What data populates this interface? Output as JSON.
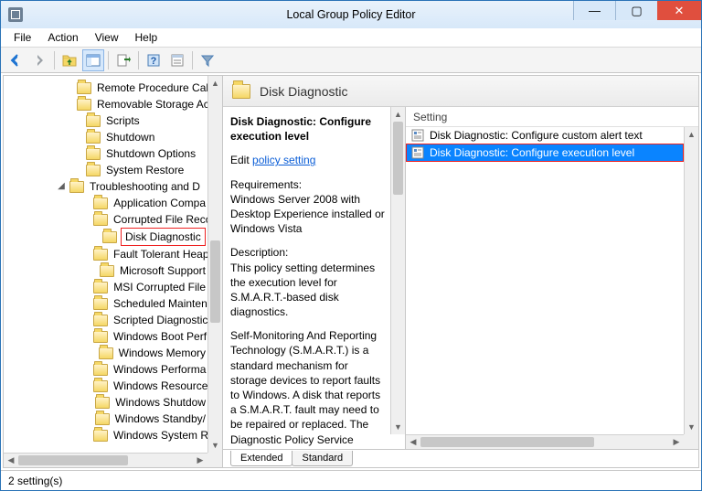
{
  "window": {
    "title": "Local Group Policy Editor"
  },
  "menubar": [
    "File",
    "Action",
    "View",
    "Help"
  ],
  "tree": {
    "top": [
      "Remote Procedure Cal",
      "Removable Storage Ac",
      "Scripts",
      "Shutdown",
      "Shutdown Options",
      "System Restore"
    ],
    "expanded": {
      "label": "Troubleshooting and D",
      "children": [
        "Application Compa",
        "Corrupted File Reco",
        "Disk Diagnostic",
        "Fault Tolerant Heap",
        "Microsoft Support",
        "MSI Corrupted File",
        "Scheduled Mainten",
        "Scripted Diagnostic",
        "Windows Boot Perf",
        "Windows Memory",
        "Windows Performa",
        "Windows Resource",
        "Windows Shutdow",
        "Windows Standby/",
        "Windows System R"
      ],
      "selected_index": 2
    }
  },
  "header": {
    "title": "Disk Diagnostic"
  },
  "description": {
    "title": "Disk Diagnostic: Configure execution level",
    "edit_prefix": "Edit ",
    "edit_link": "policy setting",
    "requirements_label": "Requirements:",
    "requirements_text": "Windows Server 2008 with Desktop Experience installed or Windows Vista",
    "description_label": "Description:",
    "description_text": "This policy setting determines the execution level for S.M.A.R.T.-based disk diagnostics.",
    "paragraph2": "Self-Monitoring And Reporting Technology (S.M.A.R.T.) is a standard mechanism for storage devices to report faults to Windows. A disk that reports a S.M.A.R.T. fault may need to be repaired or replaced. The Diagnostic Policy Service (DPS)"
  },
  "list": {
    "column": "Setting",
    "items": [
      "Disk Diagnostic: Configure custom alert text",
      "Disk Diagnostic: Configure execution level"
    ],
    "selected_index": 1
  },
  "tabs": {
    "extended": "Extended",
    "standard": "Standard",
    "active": "extended"
  },
  "status": "2 setting(s)"
}
